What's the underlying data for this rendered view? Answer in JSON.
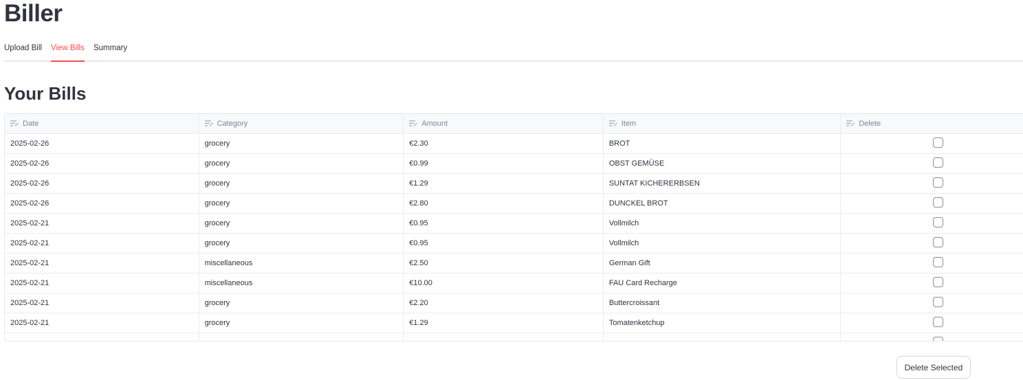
{
  "app": {
    "title": "Biller"
  },
  "tabs": [
    {
      "label": "Upload Bill",
      "active": false
    },
    {
      "label": "View Bills",
      "active": true
    },
    {
      "label": "Summary",
      "active": false
    }
  ],
  "section": {
    "title": "Your Bills"
  },
  "table": {
    "columns": [
      "Date",
      "Category",
      "Amount",
      "Item",
      "Delete"
    ],
    "rows": [
      {
        "date": "2025-02-26",
        "category": "grocery",
        "amount": "€2.30",
        "item": "BROT",
        "delete": false
      },
      {
        "date": "2025-02-26",
        "category": "grocery",
        "amount": "€0.99",
        "item": "OBST GEMÜSE",
        "delete": false
      },
      {
        "date": "2025-02-26",
        "category": "grocery",
        "amount": "€1.29",
        "item": "SUNTAT KICHERERBSEN",
        "delete": false
      },
      {
        "date": "2025-02-26",
        "category": "grocery",
        "amount": "€2.80",
        "item": "DUNCKEL BROT",
        "delete": false
      },
      {
        "date": "2025-02-21",
        "category": "grocery",
        "amount": "€0.95",
        "item": "Vollmilch",
        "delete": false
      },
      {
        "date": "2025-02-21",
        "category": "grocery",
        "amount": "€0.95",
        "item": "Vollmilch",
        "delete": false
      },
      {
        "date": "2025-02-21",
        "category": "miscellaneous",
        "amount": "€2.50",
        "item": "German Gift",
        "delete": false
      },
      {
        "date": "2025-02-21",
        "category": "miscellaneous",
        "amount": "€10.00",
        "item": "FAU Card Recharge",
        "delete": false
      },
      {
        "date": "2025-02-21",
        "category": "grocery",
        "amount": "€2.20",
        "item": "Buttercroissant",
        "delete": false
      },
      {
        "date": "2025-02-21",
        "category": "grocery",
        "amount": "€1.29",
        "item": "Tomatenketchup",
        "delete": false
      },
      {
        "date": "",
        "category": "",
        "amount": "",
        "item": "",
        "delete": false
      }
    ]
  },
  "actions": {
    "delete_selected_label": "Delete Selected"
  },
  "icons": {
    "column_header": "editable-column-icon"
  },
  "colors": {
    "accent": "#ff4b4b",
    "text": "#31333f",
    "muted": "#808495",
    "border": "#e6e7ea"
  }
}
